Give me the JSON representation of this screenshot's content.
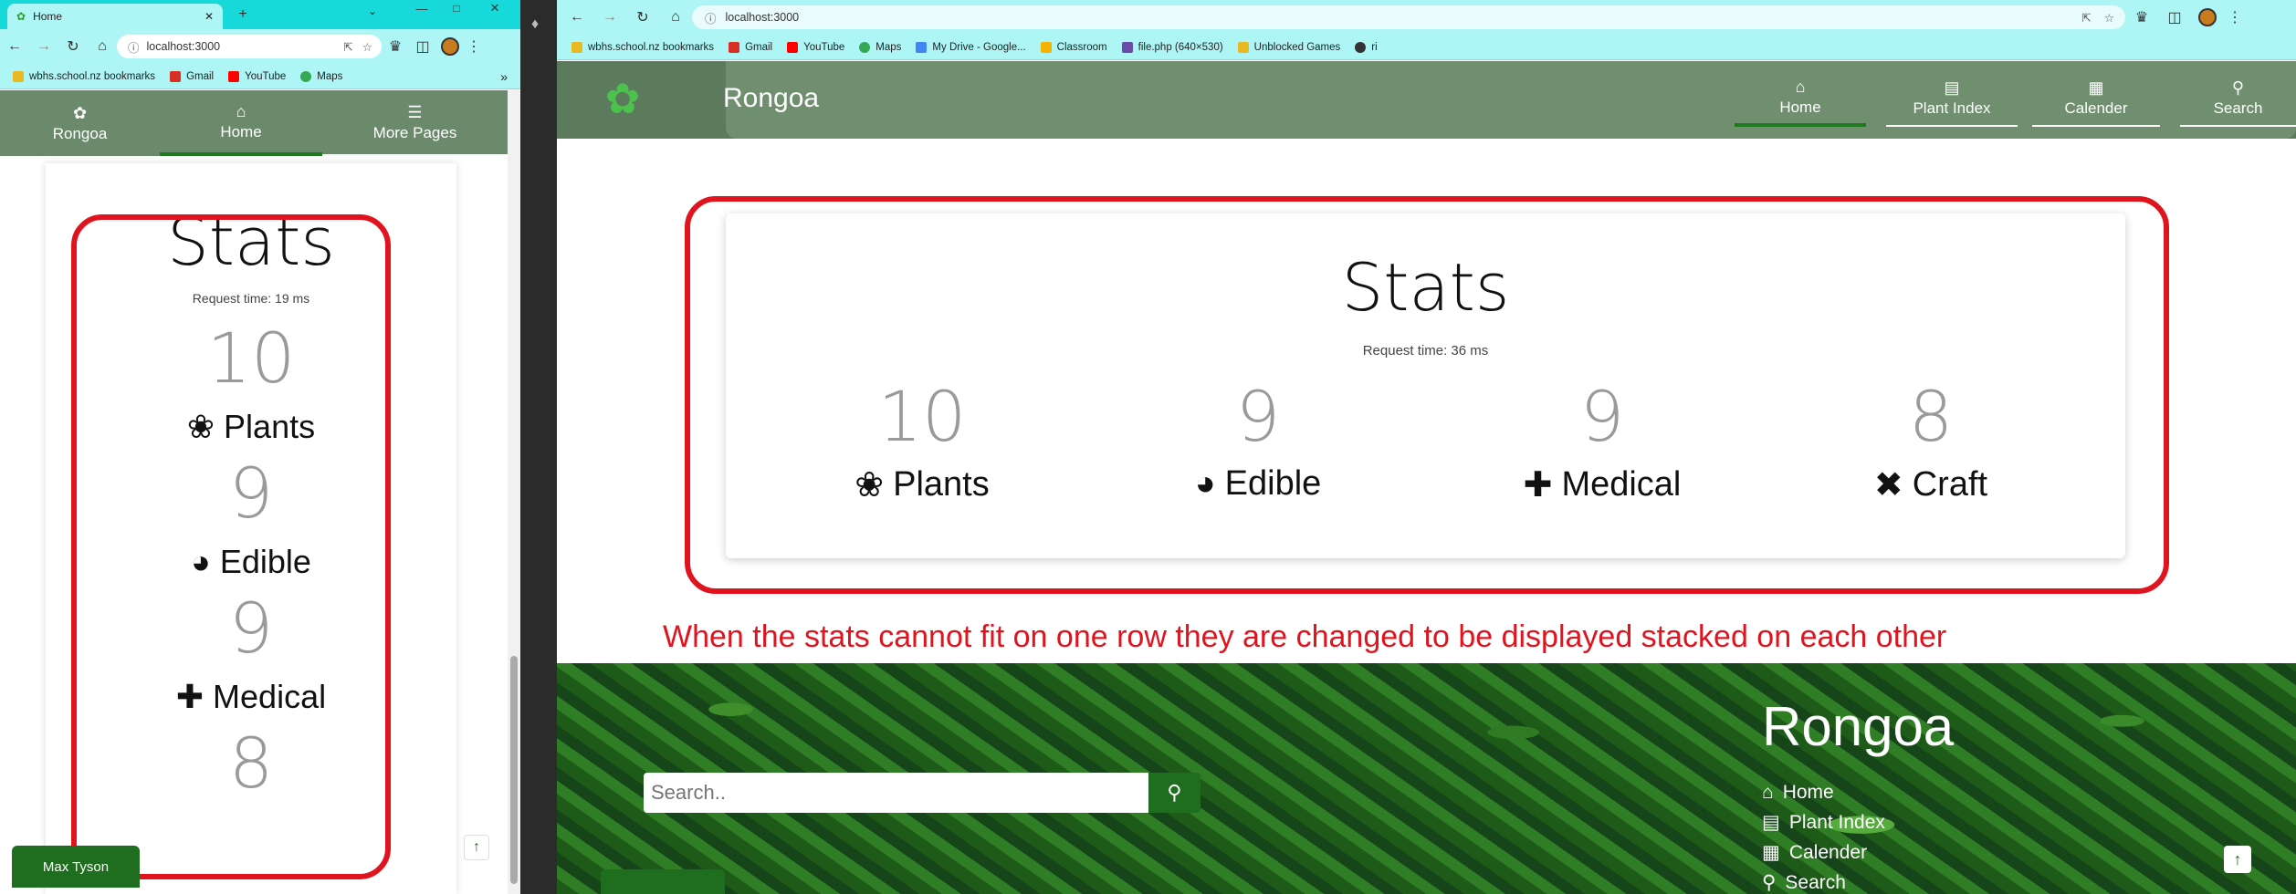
{
  "left_window": {
    "tab_title": "Home",
    "url": "localhost:3000",
    "bookmarks": [
      {
        "label": "wbhs.school.nz bookmarks",
        "color": "#e8b923"
      },
      {
        "label": "Gmail",
        "color": "#d93025"
      },
      {
        "label": "YouTube",
        "color": "#ff0000"
      },
      {
        "label": "Maps",
        "color": "#34a853"
      }
    ],
    "nav": [
      {
        "label": "Rongoa",
        "icon": "leaf-icon"
      },
      {
        "label": "Home",
        "icon": "home-icon"
      },
      {
        "label": "More Pages",
        "icon": "menu-icon"
      }
    ],
    "stats": {
      "title": "Stats",
      "request_time": "Request time: 19 ms",
      "items": [
        {
          "value": "10",
          "label": "Plants",
          "icon": "seedling-icon"
        },
        {
          "value": "9",
          "label": "Edible",
          "icon": "bowl-icon"
        },
        {
          "value": "9",
          "label": "Medical",
          "icon": "medical-book-icon"
        },
        {
          "value": "8"
        }
      ]
    },
    "user_button": "Max Tyson"
  },
  "right_window": {
    "url": "localhost:3000",
    "bookmarks": [
      {
        "label": "wbhs.school.nz bookmarks",
        "color": "#e8b923"
      },
      {
        "label": "Gmail",
        "color": "#d93025"
      },
      {
        "label": "YouTube",
        "color": "#ff0000"
      },
      {
        "label": "Maps",
        "color": "#34a853"
      },
      {
        "label": "My Drive - Google...",
        "color": "#4285f4"
      },
      {
        "label": "Classroom",
        "color": "#f4b400"
      },
      {
        "label": "file.php (640×530)",
        "color": "#6a4ca8"
      },
      {
        "label": "Unblocked Games",
        "color": "#e8b923"
      },
      {
        "label": "ri",
        "color": "#333333"
      }
    ],
    "brand": "Rongoa",
    "nav": [
      {
        "label": "Home",
        "icon": "home-icon"
      },
      {
        "label": "Plant Index",
        "icon": "book-icon"
      },
      {
        "label": "Calender",
        "icon": "calendar-icon"
      },
      {
        "label": "Search",
        "icon": "search-icon"
      }
    ],
    "stats": {
      "title": "Stats",
      "request_time": "Request time: 36 ms",
      "items": [
        {
          "value": "10",
          "label": "Plants",
          "icon": "seedling-icon"
        },
        {
          "value": "9",
          "label": "Edible",
          "icon": "bowl-icon"
        },
        {
          "value": "9",
          "label": "Medical",
          "icon": "medical-book-icon"
        },
        {
          "value": "8",
          "label": "Craft",
          "icon": "tools-icon"
        }
      ]
    },
    "annotation": "When the stats cannot fit on one row they are changed to be displayed stacked on each other",
    "footer": {
      "search_placeholder": "Search..",
      "brand": "Rongoa",
      "links": [
        {
          "label": "Home",
          "icon": "home-icon"
        },
        {
          "label": "Plant Index",
          "icon": "book-icon"
        },
        {
          "label": "Calender",
          "icon": "calendar-icon"
        },
        {
          "label": "Search",
          "icon": "search-icon"
        }
      ]
    }
  },
  "colors": {
    "chrome": "#aef5f5",
    "titlebar": "#17d9d9",
    "nav_green": "#6b8a6b",
    "active_underline": "#1f7a1f",
    "annotation_red": "#e0141f"
  }
}
